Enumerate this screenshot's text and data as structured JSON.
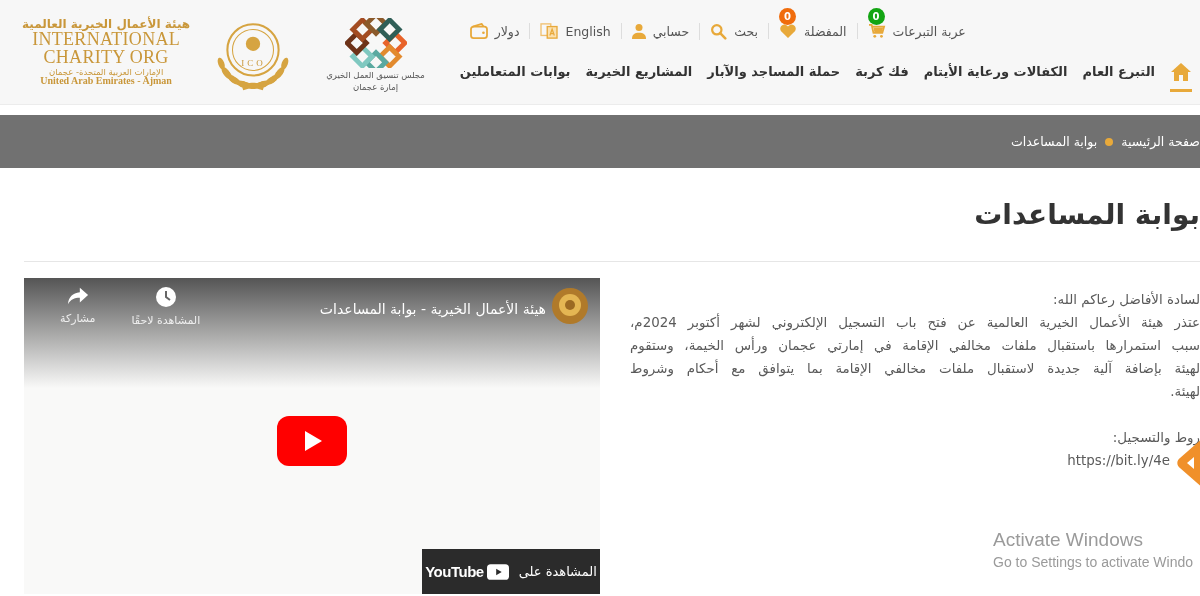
{
  "header": {
    "logo": {
      "arabic_name": "هيئة الأعمال الخيرية العالمية",
      "english_name_1": "INTERNATIONAL",
      "english_name_2": "CHARITY ORG",
      "arabic_location": "الإمارات العربية المتحدة- عجمان",
      "english_location": "United Arab Emirates - Ajman",
      "emblem_text": "ICO"
    },
    "council_logo": {
      "line_1": "مجلس تنسيق العمل الخيري",
      "line_2": "إمارة عجمان"
    },
    "top_links": [
      {
        "kind": "cart",
        "label": "عربة التبرعات",
        "badge": "0",
        "color": "#13a513"
      },
      {
        "kind": "favorites",
        "label": "المفضلة",
        "badge": "0",
        "color": "#f06c0c"
      },
      {
        "kind": "search",
        "label": "بحث"
      },
      {
        "kind": "account",
        "label": "حسابي"
      },
      {
        "kind": "language",
        "label": "English"
      },
      {
        "kind": "currency",
        "label": "دولار"
      }
    ],
    "nav": [
      {
        "kind": "home",
        "selected": true
      },
      {
        "kind": "link",
        "label": "التبرع العام",
        "selected": false
      },
      {
        "kind": "link",
        "label": "الكفالات ورعاية الأيتام",
        "selected": false
      },
      {
        "kind": "link",
        "label": "فك كربة",
        "selected": false
      },
      {
        "kind": "link",
        "label": "حملة المساجد والآبار",
        "selected": false
      },
      {
        "kind": "link",
        "label": "المشاريع الخيرية",
        "selected": false
      },
      {
        "kind": "link",
        "label": "بوابات المتعاملين",
        "selected": false
      }
    ]
  },
  "breadcrumb": [
    "صفحة الرئيسية",
    "بوابة المساعدات"
  ],
  "page_title": "بوابة المساعدات",
  "video": {
    "title": "هيئة الأعمال الخيرية - بوابة المساعدات",
    "actions": [
      {
        "kind": "watch-later",
        "label": "المشاهدة لاحقًا"
      },
      {
        "kind": "share",
        "label": "مشاركة"
      }
    ],
    "watch_on": "المشاهدة على",
    "brand": "YouTube"
  },
  "article": {
    "paragraphs": [
      {
        "lines": [
          {
            "text": "لسادة الأفاضل رعاكم الله:"
          },
          {
            "text": "عتذر هيئة الأعمال الخيرية العالمية عن فتح باب التسجيل الإلكتروني لشهر أكتوبر 2024م،",
            "justified": true
          },
          {
            "text": "سبب استمرارها باستقبال ملفات مخالفي الإقامة في إمارتي عجمان ورأس الخيمة، وستقوم",
            "justified": true
          },
          {
            "text": "لهيئة بإضافة آلية جديدة لاستقبال ملفات مخالفي الإقامة بما يتوافق مع أحكام وشروط",
            "justified": true
          },
          {
            "text": "لهيئة."
          }
        ]
      },
      {
        "lines": [
          {
            "text": "روط والتسجيل:"
          },
          {
            "text": "https://bit.ly/4e"
          }
        ]
      }
    ]
  },
  "os_notice": {
    "title": "Activate Windows",
    "subtitle": "Go to Settings to activate Windo"
  }
}
